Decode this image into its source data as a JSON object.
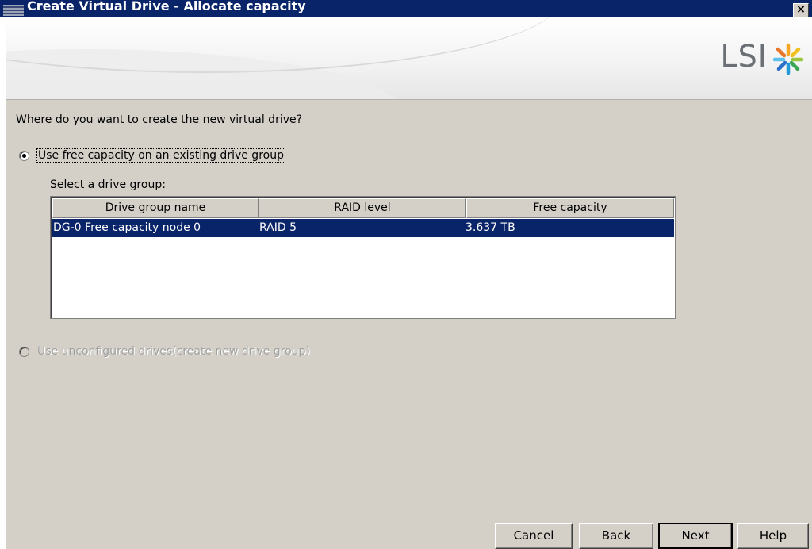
{
  "window": {
    "title": "Create Virtual Drive - Allocate capacity",
    "close_glyph": "×"
  },
  "brand": {
    "logo_text": "LSI",
    "logo_mark": "lsi-starburst-icon"
  },
  "prompt": "Where do you want to create the new virtual drive?",
  "option_existing": {
    "label": "Use free capacity on an existing drive group",
    "selected": true,
    "enabled": true
  },
  "select_label": "Select a drive group:",
  "table": {
    "columns": [
      "Drive group name",
      "RAID level",
      "Free capacity"
    ],
    "rows": [
      {
        "name": "DG-0 Free capacity node 0",
        "raid": "RAID 5",
        "capacity": "3.637 TB",
        "selected": true
      }
    ]
  },
  "option_unconfigured": {
    "label": "Use unconfigured drives(create new drive group)",
    "selected": false,
    "enabled": false
  },
  "buttons": {
    "cancel": "Cancel",
    "back": "Back",
    "next": "Next",
    "help": "Help"
  },
  "colors": {
    "title_bar": "#0a246a",
    "selection": "#0a246a",
    "dialog_bg": "#d4d0c8"
  }
}
